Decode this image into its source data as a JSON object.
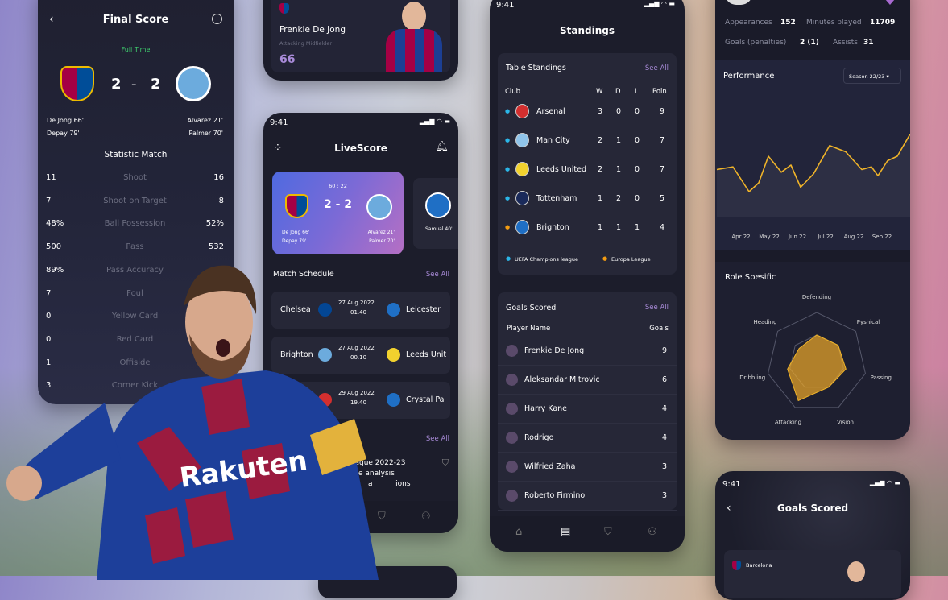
{
  "colors": {
    "panel": "#1c1d2b",
    "card": "#262737",
    "accent_purple": "#a98bd9",
    "full_time_green": "#3ecf6e",
    "chart_line": "#f0b429",
    "ucl_dot": "#2bb6e8",
    "uel_dot": "#f39c12"
  },
  "final_score": {
    "title": "Final Score",
    "status": "Full Time",
    "home_score": "2",
    "separator": "-",
    "away_score": "2",
    "home_scorers": [
      "De Jong 66'",
      "Depay 79'"
    ],
    "away_scorers": [
      "Alvarez 21'",
      "Palmer 70'"
    ],
    "section_title": "Statistic Match",
    "stats": [
      {
        "home": "11",
        "label": "Shoot",
        "away": "16"
      },
      {
        "home": "7",
        "label": "Shoot on Target",
        "away": "8"
      },
      {
        "home": "48%",
        "label": "Ball Possession",
        "away": "52%"
      },
      {
        "home": "500",
        "label": "Pass",
        "away": "532"
      },
      {
        "home": "89%",
        "label": "Pass Accuracy",
        "away": ""
      },
      {
        "home": "7",
        "label": "Foul",
        "away": ""
      },
      {
        "home": "0",
        "label": "Yellow Card",
        "away": ""
      },
      {
        "home": "0",
        "label": "Red Card",
        "away": ""
      },
      {
        "home": "1",
        "label": "Offiside",
        "away": ""
      },
      {
        "home": "3",
        "label": "Corner Kick",
        "away": ""
      }
    ]
  },
  "player_card": {
    "name": "Frenkie De Jong",
    "position": "Attacking Midfielder",
    "rating": "66"
  },
  "livescore": {
    "time": "9:41",
    "title": "LiveScore",
    "match_clock": "60 : 22",
    "score": "2 - 2",
    "home_scorers": [
      "De Jong 66'",
      "Depay 79'"
    ],
    "away_scorers": [
      "Alvarez 21'",
      "Palmer 70'"
    ],
    "side_card_scorer": "Samual 40'",
    "schedule_title": "Match Schedule",
    "see_all": "See All",
    "schedule": [
      {
        "home": "Chelsea",
        "date": "27 Aug 2022",
        "time": "01.40",
        "away": "Leicester"
      },
      {
        "home": "Brighton",
        "date": "27 Aug 2022",
        "time": "00.10",
        "away": "Leeds Unit"
      },
      {
        "home": "",
        "date": "29 Aug 2022",
        "time": "19.40",
        "away": "Crystal Pa"
      }
    ],
    "news_see_all": "See All",
    "news_text": [
      "es League 2022-23",
      "p stage analysis",
      "a          ions"
    ]
  },
  "standings": {
    "time": "9:41",
    "title": "Standings",
    "table_title": "Table Standings",
    "see_all": "See All",
    "columns": [
      "Club",
      "W",
      "D",
      "L",
      "Poin"
    ],
    "rows": [
      {
        "club": "Arsenal",
        "w": "3",
        "d": "0",
        "l": "0",
        "pts": "9",
        "zone": "ucl",
        "crest": "#d32f2f"
      },
      {
        "club": "Man City",
        "w": "2",
        "d": "1",
        "l": "0",
        "pts": "7",
        "zone": "ucl",
        "crest": "#8fc4ea"
      },
      {
        "club": "Leeds United",
        "w": "2",
        "d": "1",
        "l": "0",
        "pts": "7",
        "zone": "ucl",
        "crest": "#f2d22e"
      },
      {
        "club": "Tottenham",
        "w": "1",
        "d": "2",
        "l": "0",
        "pts": "5",
        "zone": "ucl",
        "crest": "#1a2a5a"
      },
      {
        "club": "Brighton",
        "w": "1",
        "d": "1",
        "l": "1",
        "pts": "4",
        "zone": "uel",
        "crest": "#1f6fc5"
      }
    ],
    "legend": [
      "UEFA Champions league",
      "Europa League"
    ],
    "goals_title": "Goals Scored",
    "goals_see_all": "See All",
    "goals_columns": [
      "Player Name",
      "Goals"
    ],
    "goals": [
      {
        "player": "Frenkie De Jong",
        "goals": "9"
      },
      {
        "player": "Aleksandar Mitrovic",
        "goals": "6"
      },
      {
        "player": "Harry Kane",
        "goals": "4"
      },
      {
        "player": "Rodrigo",
        "goals": "4"
      },
      {
        "player": "Wilfried Zaha",
        "goals": "3"
      },
      {
        "player": "Roberto Firmino",
        "goals": "3"
      }
    ]
  },
  "profile": {
    "appearances_label": "Appearances",
    "appearances": "152",
    "minutes_label": "Minutes played",
    "minutes": "11709",
    "goals_label": "Goals (penalties)",
    "goals": "2 (1)",
    "assists_label": "Assists",
    "assists": "31",
    "performance_title": "Performance",
    "season": "Season 22/23",
    "role_title": "Role Spesific",
    "radar": {
      "axes": [
        "Defending",
        "Pyshical",
        "Passing",
        "Vision",
        "Attacking",
        "Dribbling",
        "Heading"
      ],
      "values": [
        0.55,
        0.55,
        0.6,
        0.55,
        0.85,
        0.6,
        0.45
      ]
    }
  },
  "chart_data": {
    "type": "line",
    "categories": [
      "Apr 22",
      "May 22",
      "Jun 22",
      "Jul 22",
      "Aug 22",
      "Sep 22"
    ],
    "x": [
      0,
      0.5,
      1,
      1.3,
      1.6,
      2,
      2.3,
      2.6,
      3,
      3.5,
      4,
      4.5,
      4.8,
      5,
      5.3,
      5.6,
      6
    ],
    "values": [
      45,
      48,
      20,
      30,
      60,
      42,
      50,
      25,
      40,
      72,
      65,
      45,
      48,
      38,
      55,
      60,
      85
    ],
    "grid": false
  },
  "goals_screen": {
    "time": "9:41",
    "title": "Goals Scored",
    "club": "Barcelona"
  }
}
